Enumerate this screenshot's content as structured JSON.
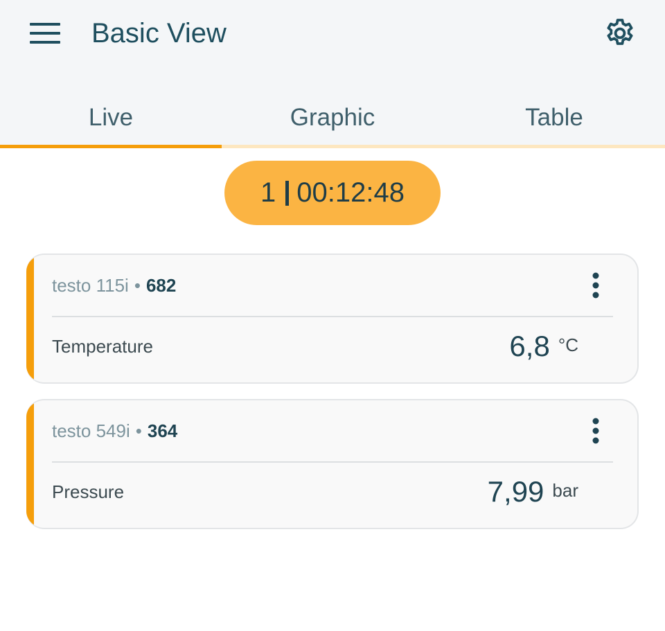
{
  "header": {
    "title": "Basic View",
    "menu_icon": "hamburger-menu-icon",
    "settings_icon": "gear-icon"
  },
  "tabs": [
    {
      "label": "Live",
      "active": true
    },
    {
      "label": "Graphic",
      "active": false
    },
    {
      "label": "Table",
      "active": false
    }
  ],
  "timer": {
    "count": "1",
    "elapsed": "00:12:48"
  },
  "devices": [
    {
      "name": "testo 115i",
      "separator": "•",
      "serial": "682",
      "measurement_label": "Temperature",
      "value": "6,8",
      "unit": "°C"
    },
    {
      "name": "testo 549i",
      "separator": "•",
      "serial": "364",
      "measurement_label": "Pressure",
      "value": "7,99",
      "unit": "bar"
    }
  ],
  "colors": {
    "accent": "#f59e0b",
    "timer_pill": "#fbb443",
    "title_text": "#1f4f5f"
  }
}
